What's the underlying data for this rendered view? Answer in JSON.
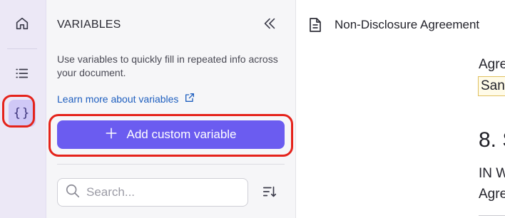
{
  "rail": {
    "items": [
      {
        "name": "home",
        "icon": "home-icon"
      },
      {
        "name": "outline",
        "icon": "list-icon"
      },
      {
        "name": "variables",
        "icon": "braces-icon",
        "label": "{}",
        "selected": true
      }
    ]
  },
  "panel": {
    "title": "VARIABLES",
    "description": "Use variables to quickly fill in repeated info across your document.",
    "learn_link": "Learn more about variables",
    "add_button": "Add custom variable",
    "search_placeholder": "Search...",
    "search_value": ""
  },
  "document": {
    "title": "Non-Disclosure Agreement",
    "lines": [
      "Agre",
      "San",
      "8. S",
      "IN W",
      "Agre"
    ]
  },
  "colors": {
    "accent": "#6b5cf0",
    "highlight_ring": "#e5231b",
    "link": "#1f5fbf",
    "rail_bg": "#ece8f6",
    "rail_selected": "#cfc8f6"
  }
}
